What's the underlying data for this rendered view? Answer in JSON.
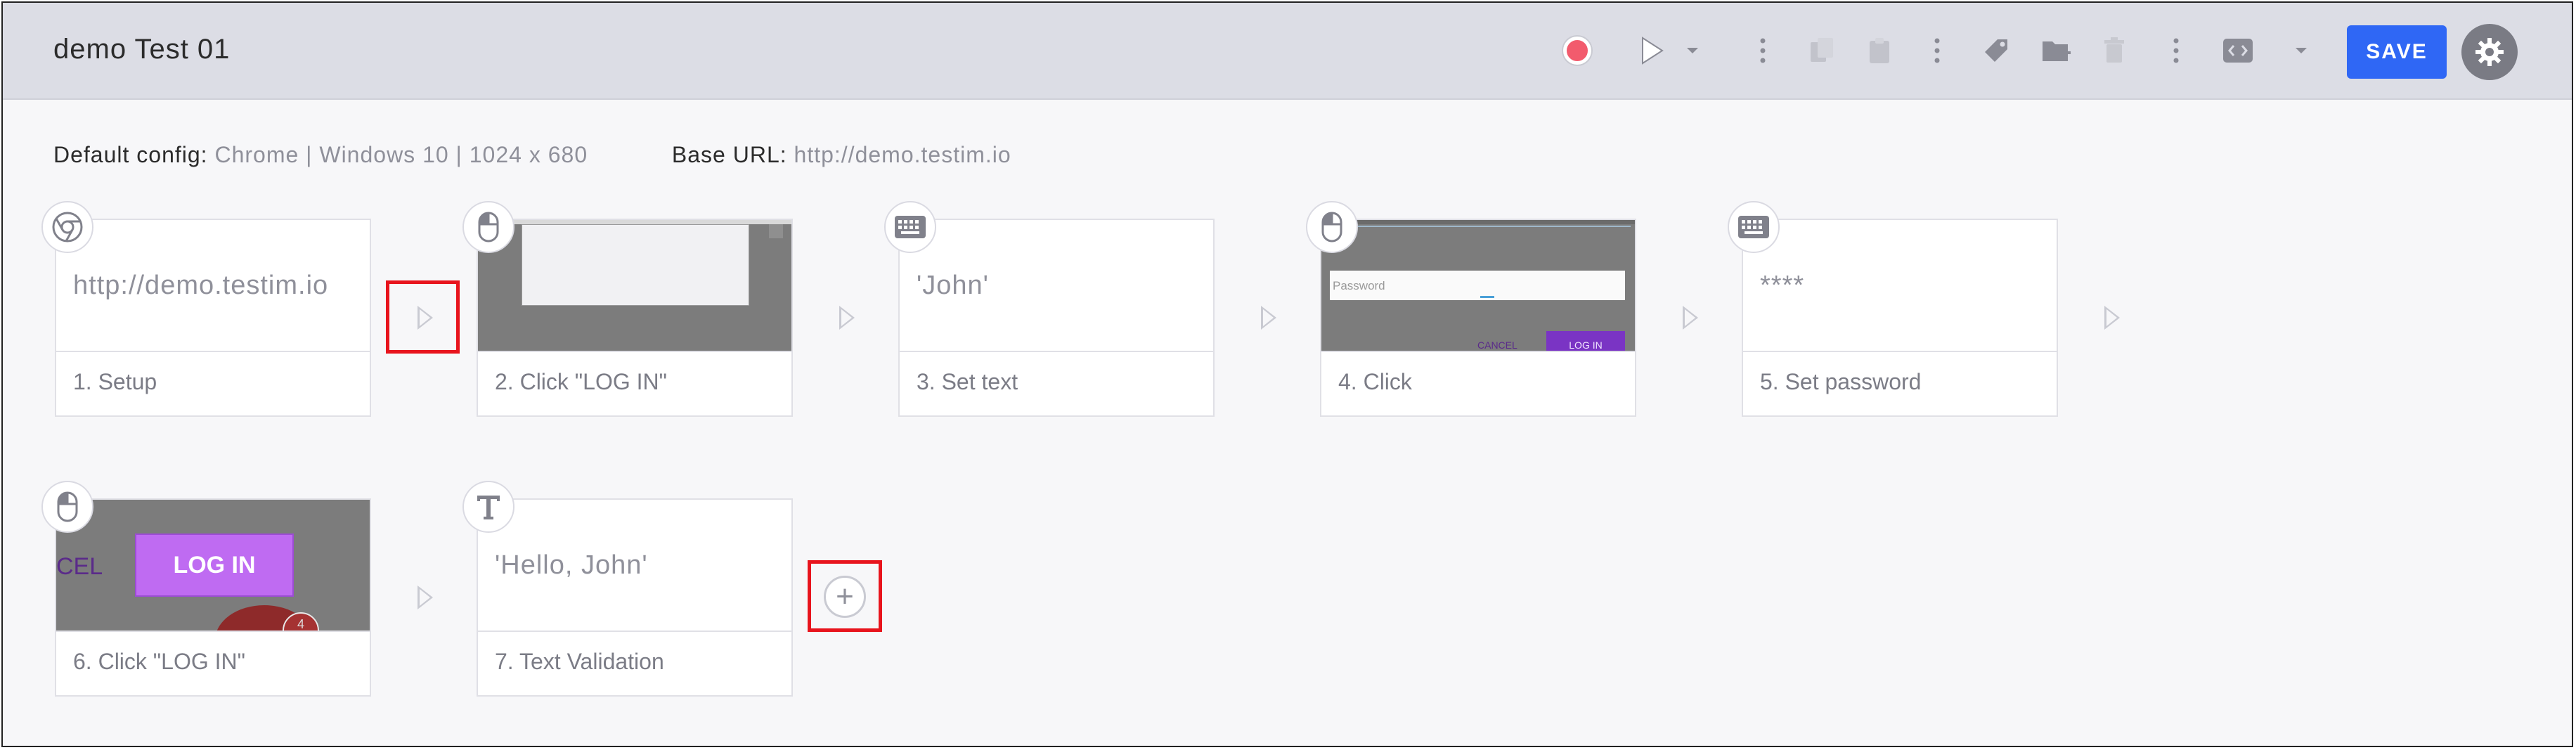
{
  "header": {
    "title": "demo Test 01",
    "save_label": "SAVE",
    "icons": [
      "record-icon",
      "play-icon",
      "dropdown-icon",
      "more-icon",
      "copy-icon",
      "paste-icon",
      "more-icon",
      "tag-icon",
      "add-folder-icon",
      "trash-icon",
      "more-icon",
      "code-icon",
      "dropdown-icon",
      "gear-icon"
    ],
    "record_color": "#f25b6d",
    "save_color": "#2f67f5"
  },
  "config": {
    "default_label": "Default config:",
    "default_value": "Chrome | Windows 10 | 1024 x 680",
    "base_label": "Base URL:",
    "base_value": "http://demo.testim.io"
  },
  "steps": [
    {
      "label": "1. Setup",
      "preview_text": "http://demo.testim.io",
      "icon": "chrome-icon"
    },
    {
      "label": "2. Click \"LOG IN\"",
      "icon": "mouse-icon"
    },
    {
      "label": "3. Set text",
      "preview_text": "'John'",
      "icon": "keyboard-icon"
    },
    {
      "label": "4. Click",
      "icon": "mouse-icon",
      "preview": {
        "placeholder": "Password",
        "cancel": "CANCEL",
        "login": "LOG IN"
      }
    },
    {
      "label": "5. Set password",
      "preview_text": "****",
      "icon": "keyboard-icon"
    },
    {
      "label": "6. Click \"LOG IN\"",
      "icon": "mouse-icon",
      "preview": {
        "cancel": "CEL",
        "login": "LOG IN",
        "badge": "4"
      }
    },
    {
      "label": "7. Text Validation",
      "preview_text": "'Hello, John'",
      "icon": "text-icon"
    }
  ],
  "add_step": "+"
}
